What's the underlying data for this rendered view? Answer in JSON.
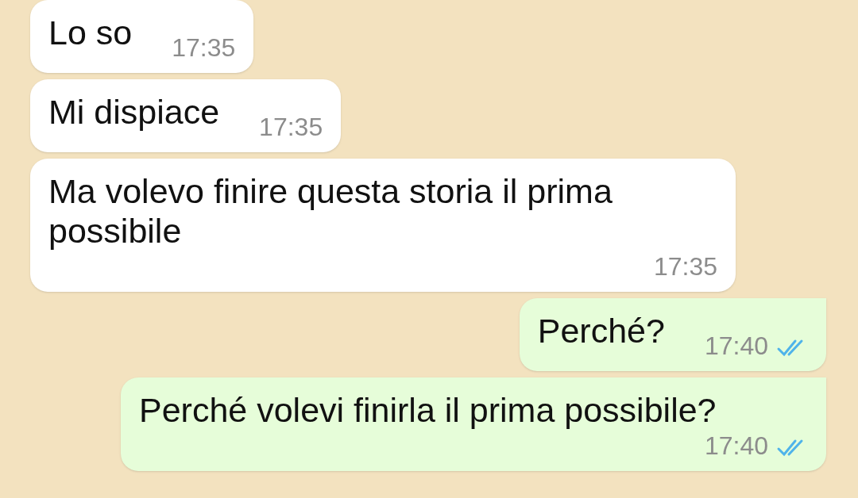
{
  "messages": [
    {
      "kind": "incoming",
      "text": "Lo so",
      "time": "17:35"
    },
    {
      "kind": "incoming",
      "text": "Mi dispiace",
      "time": "17:35"
    },
    {
      "kind": "incoming",
      "text": "Ma volevo finire questa storia il prima possibile",
      "time": "17:35"
    },
    {
      "kind": "outgoing",
      "text": "Perché?",
      "time": "17:40",
      "read": true
    },
    {
      "kind": "outgoing",
      "text": "Perché volevi finirla il prima possibile?",
      "time": "17:40",
      "read": true
    }
  ]
}
